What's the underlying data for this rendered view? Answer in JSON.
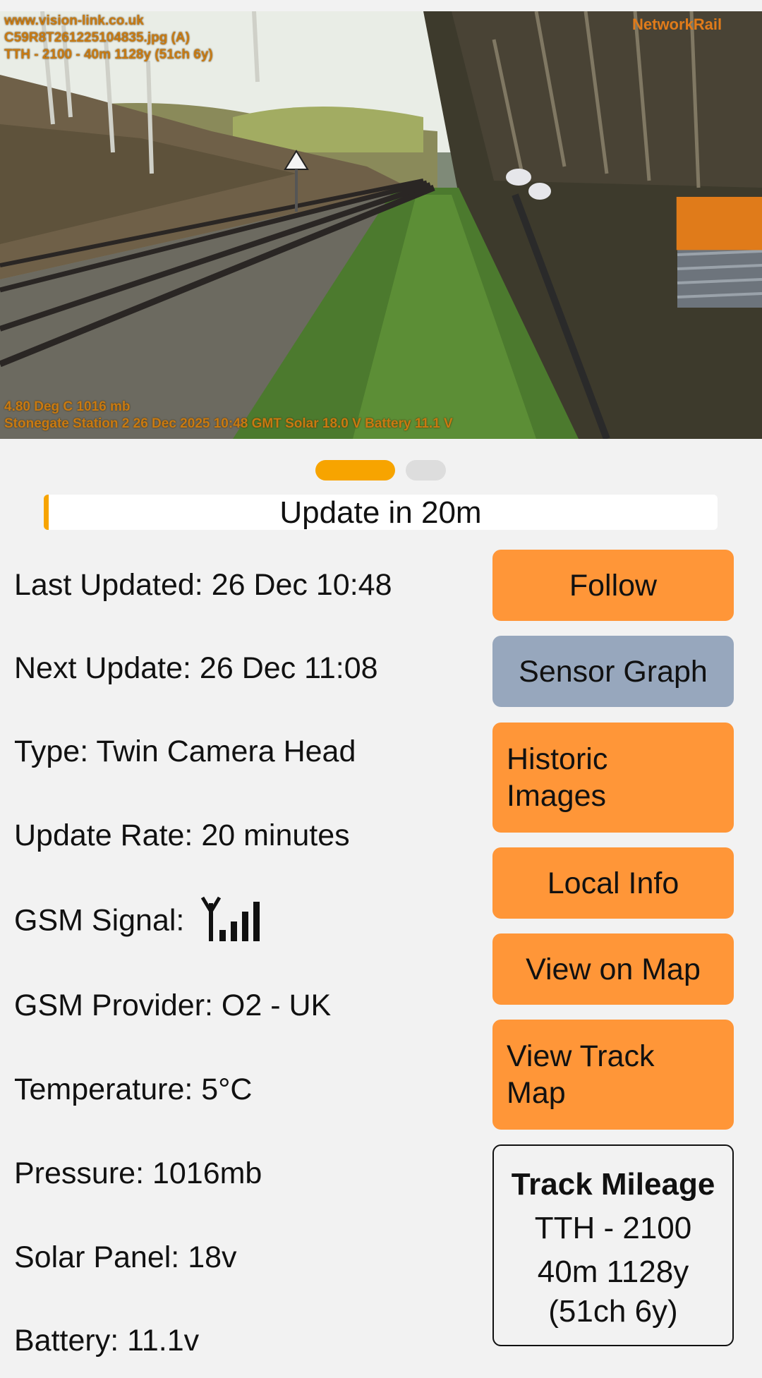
{
  "camera": {
    "overlay_top": [
      "www.vision-link.co.uk",
      "C59R8T261225104835.jpg (A)",
      "TTH - 2100 - 40m 1128y (51ch 6y)"
    ],
    "overlay_bottom": [
      "4.80 Deg C 1016 mb",
      "Stonegate Station 2 26 Dec 2025 10:48 GMT Solar 18.0 V Battery 11.1 V"
    ],
    "logo_text": "NetworkRail"
  },
  "pager": {
    "active_index": 0,
    "count": 2
  },
  "update_bar": {
    "label": "Update in 20m",
    "progress": 0.007
  },
  "info": {
    "last_updated": "Last Updated: 26 Dec 10:48",
    "next_update": "Next Update: 26 Dec 11:08",
    "type": "Type: Twin Camera Head",
    "update_rate": "Update Rate: 20 minutes",
    "gsm_signal_label": "GSM Signal:",
    "gsm_signal_bars": 4,
    "gsm_provider": "GSM Provider: O2 - UK",
    "temperature": "Temperature: 5°C",
    "pressure": "Pressure: 1016mb",
    "solar_panel": "Solar Panel: 18v",
    "battery": "Battery: 11.1v"
  },
  "buttons": {
    "follow": "Follow",
    "sensor_graph": "Sensor Graph",
    "historic_images": [
      "Historic",
      "Images"
    ],
    "local_info": "Local Info",
    "view_on_map": "View on Map",
    "view_track_map": [
      "View Track",
      "Map"
    ]
  },
  "track_mileage": {
    "title": "Track Mileage",
    "lines": [
      "TTH - 2100",
      "40m 1128y",
      "(51ch 6y)"
    ]
  },
  "colors": {
    "accent_orange": "#ff9638",
    "progress_orange": "#f7a400",
    "button_grey": "#97a7bd",
    "background": "#f2f2f2",
    "overlay_text": "#c97a12"
  }
}
